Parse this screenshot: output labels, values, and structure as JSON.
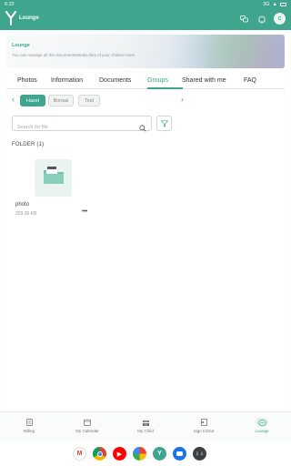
{
  "status": {
    "time": "6:22",
    "signal": "3G"
  },
  "app": {
    "title": "Lounge",
    "avatar_initial": "C"
  },
  "banner": {
    "title": "Lounge",
    "subtitle": "You can manage all the documents/Media files of your children here."
  },
  "tabs": [
    {
      "label": "Photos",
      "active": false
    },
    {
      "label": "Information",
      "active": false
    },
    {
      "label": "Documents",
      "active": false
    },
    {
      "label": "Groups",
      "active": true
    },
    {
      "label": "Shared with me",
      "active": false
    },
    {
      "label": "FAQ",
      "active": false
    }
  ],
  "chips": [
    {
      "label": "Hazel",
      "active": true
    },
    {
      "label": "Bonsai",
      "active": false
    },
    {
      "label": "Test",
      "active": false
    }
  ],
  "search": {
    "placeholder": "Search for file",
    "value": ""
  },
  "folder_section": {
    "heading": "FOLDER (1)"
  },
  "folders": [
    {
      "name": "photo",
      "size": "329.36 KB"
    }
  ],
  "bottom_nav": [
    {
      "label": "Billing",
      "icon": "billing-icon",
      "active": false
    },
    {
      "label": "My Calendar",
      "icon": "calendar-icon",
      "active": false
    },
    {
      "label": "My Child",
      "icon": "child-icon",
      "active": false
    },
    {
      "label": "Sign In/Out",
      "icon": "sign-in-out-icon",
      "active": false
    },
    {
      "label": "Lounge",
      "icon": "lounge-icon",
      "active": true
    }
  ],
  "dock": [
    "gmail-icon",
    "chrome-icon",
    "youtube-icon",
    "photos-icon",
    "lounge-app-icon",
    "messages-icon",
    "app-drawer-icon"
  ],
  "colors": {
    "accent": "#3fa58f",
    "accent_light": "#e9f4f1"
  }
}
